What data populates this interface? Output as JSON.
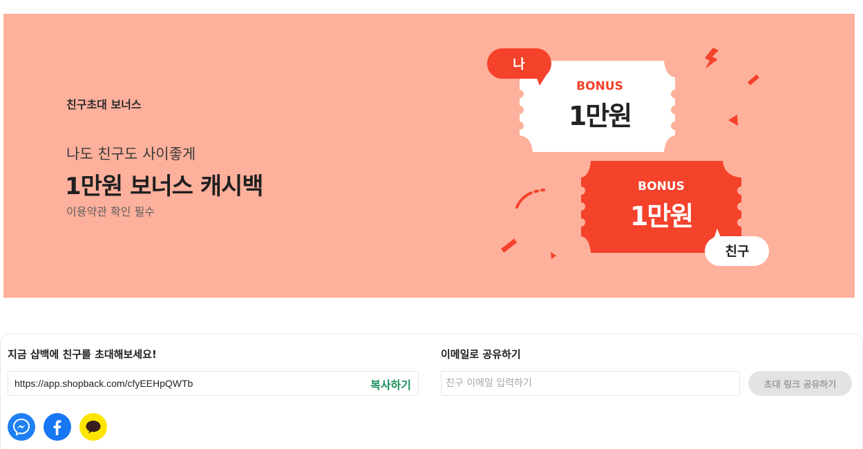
{
  "banner": {
    "eyebrow": "친구초대 보너스",
    "subtitle": "나도 친구도 사이좋게",
    "title": "1만원 보너스 캐시백",
    "note": "이용약관 확인 필수",
    "background_color": "#fdb09c",
    "ticket_me": {
      "bubble_label": "나",
      "bonus_label": "BONUS",
      "amount": "1만원"
    },
    "ticket_friend": {
      "bubble_label": "친구",
      "bonus_label": "BONUS",
      "amount": "1만원"
    },
    "accent_color": "#f4422b"
  },
  "share": {
    "invite_heading": "지금 샵백에 친구를 초대해보세요!",
    "invite_link": "https://app.shopback.com/cfyEEHpQWTb",
    "copy_label": "복사하기",
    "email_heading": "이메일로 공유하기",
    "email_value": "",
    "email_placeholder": "친구 이메일 입력하기",
    "share_button_label": "초대 링크 공유하기",
    "social_icons": [
      "messenger-icon",
      "facebook-icon",
      "kakaotalk-icon"
    ],
    "copy_color": "#1a8f5a"
  }
}
